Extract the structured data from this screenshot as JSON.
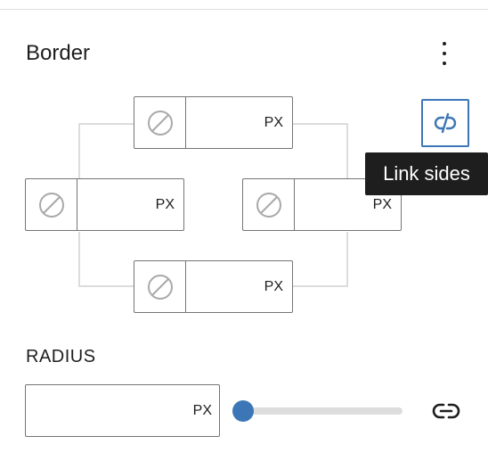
{
  "panel": {
    "title": "Border",
    "options_icon": "more-vertical-icon"
  },
  "border": {
    "sides": [
      {
        "side": "top",
        "style_icon": "no-style-icon",
        "value": "",
        "unit": "PX"
      },
      {
        "side": "left",
        "style_icon": "no-style-icon",
        "value": "",
        "unit": "PX"
      },
      {
        "side": "right",
        "style_icon": "no-style-icon",
        "value": "",
        "unit": "PX"
      },
      {
        "side": "bottom",
        "style_icon": "no-style-icon",
        "value": "",
        "unit": "PX"
      }
    ],
    "link_sides": {
      "icon": "unlink-icon",
      "tooltip": "Link sides",
      "linked": false
    }
  },
  "radius": {
    "label": "RADIUS",
    "value": "",
    "unit": "PX",
    "slider_value": 0,
    "link_icon": "link-icon"
  },
  "colors": {
    "accent": "#3d76b6",
    "border": "#757575",
    "text": "#1e1e1e",
    "track": "#dddddd",
    "connector": "#dcdcdc",
    "tooltip_bg": "#1e1e1e"
  }
}
